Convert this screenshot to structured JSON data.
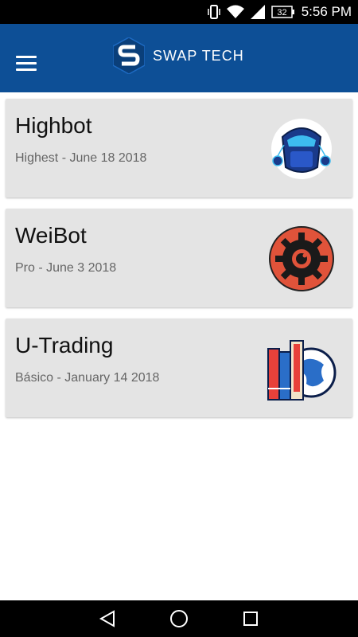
{
  "status_bar": {
    "battery": "32",
    "time": "5:56 PM"
  },
  "app": {
    "brand": "SWAP TECH"
  },
  "bots": [
    {
      "title": "Highbot",
      "subtitle": "Highest - June 18 2018",
      "icon": "robot-icon"
    },
    {
      "title": "WeiBot",
      "subtitle": "Pro - June 3 2018",
      "icon": "gear-icon"
    },
    {
      "title": "U-Trading",
      "subtitle": "Básico - January 14 2018",
      "icon": "books-globe-icon"
    }
  ],
  "colors": {
    "app_bar": "#0d4f96",
    "card": "#e4e4e4"
  }
}
